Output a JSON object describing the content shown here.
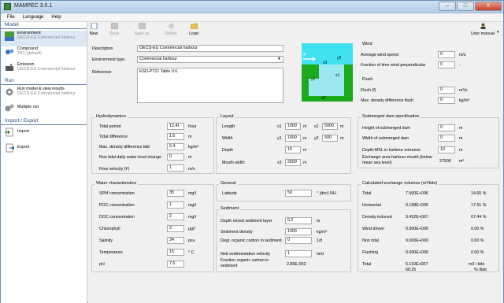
{
  "app": {
    "title": "MAMPEC 3.0.1"
  },
  "window_buttons": {
    "minimize": "–",
    "maximize": "□",
    "close": "X"
  },
  "menu": [
    "File",
    "Language",
    "Help"
  ],
  "sidebar": {
    "model_header": "Model",
    "model_items": [
      {
        "label": "Environment",
        "sub": "OECD-EU Commercial harbour"
      },
      {
        "label": "Compound",
        "sub": "TBT (default)"
      },
      {
        "label": "Emission",
        "sub": "OECD-EU Commercial harbour"
      }
    ],
    "run_header": "Run",
    "run_items": [
      {
        "label": "Run model & view results",
        "sub": "OECD-EU Commercial harbour"
      },
      {
        "label": "Multiple run",
        "sub": ""
      }
    ],
    "io_header": "Import / Export",
    "io_items": [
      {
        "label": "Import"
      },
      {
        "label": "Export"
      }
    ]
  },
  "toolbar": {
    "new": "New",
    "save": "Save",
    "save_as": "Save as new",
    "delete": "Delete",
    "load": "Load",
    "user_manual": "User manual"
  },
  "env": {
    "description_label": "Description",
    "description": "OECD-EU Commercial harbour",
    "type_label": "Environment type",
    "type": "Commercial harbour",
    "reference_label": "Reference",
    "reference": "ESD-PT21 Table 0.6"
  },
  "diagram": {
    "F": "F",
    "x1": "x1",
    "x2": "x2",
    "x3": "x3",
    "y1": "y1",
    "y2": "y2"
  },
  "wind": {
    "title": "Wind",
    "rows": [
      {
        "label": "Average wind speed",
        "value": "0",
        "unit": "m/s"
      },
      {
        "label": "Fraction of time wind perpendicular",
        "value": "0",
        "unit": "-"
      }
    ]
  },
  "flush": {
    "title": "Flush",
    "rows": [
      {
        "label": "Flush (f)",
        "value": "0",
        "unit": "m³/s"
      },
      {
        "label": "Max. density difference flush",
        "value": "0",
        "unit": "kg/m³"
      }
    ]
  },
  "dam": {
    "title": "Submerged dam specification",
    "rows": [
      {
        "label": "Height of submerged dam",
        "value": "0",
        "unit": "m"
      },
      {
        "label": "Width of submerged dam",
        "value": "0",
        "unit": "m"
      },
      {
        "label": "Depth-MSL in harbour entrance",
        "value": "10",
        "unit": "m"
      }
    ],
    "exch_label": "Exchange area harbour mouth (below mean sea level)",
    "exch_value": "37500",
    "exch_unit": "m²"
  },
  "hydro": {
    "title": "Hydrodynamics",
    "rows": [
      {
        "label": "Tidal period",
        "value": "12.41",
        "unit": "hour"
      },
      {
        "label": "Tidal difference",
        "value": "1.5",
        "unit": "m"
      },
      {
        "label": "Max. density difference tide",
        "value": "0.4",
        "unit": "kg/m³"
      },
      {
        "label": "Non tidal daily water level change",
        "value": "0",
        "unit": "m"
      },
      {
        "label": "Flow velocity (F)",
        "value": "1",
        "unit": "m/s"
      }
    ]
  },
  "layout": {
    "title": "Layout",
    "length_label": "Length",
    "x1_label": "x1",
    "x1": "1000",
    "x1_unit": "m",
    "x2_label": "x2",
    "x2": "5000",
    "x2_unit": "m",
    "width_label": "Width",
    "y1_label": "y1",
    "y1": "1000",
    "y1_unit": "m",
    "y2_label": "y2",
    "y2": "500",
    "y2_unit": "m",
    "depth_label": "Depth",
    "depth": "15",
    "depth_unit": "m",
    "mouth_label": "Mouth width",
    "x3_label": "x3",
    "x3": "2500",
    "x3_unit": "m"
  },
  "water": {
    "title": "Water characteristics",
    "rows": [
      {
        "label": "SPM concentration",
        "value": "35",
        "unit": "mg/l"
      },
      {
        "label": "POC concentration",
        "value": "1",
        "unit": "mg/l"
      },
      {
        "label": "DOC concentration",
        "value": "2",
        "unit": "mg/l"
      },
      {
        "label": "Chlorophyll",
        "value": "3",
        "unit": "µg/l"
      },
      {
        "label": "Salinity",
        "value": "34",
        "unit": "psu"
      },
      {
        "label": "Temperature",
        "value": "15",
        "unit": "° C"
      },
      {
        "label": "pH",
        "value": "7.5",
        "unit": ""
      }
    ]
  },
  "general": {
    "title": "General",
    "lat_label": "Latitude",
    "lat": "50",
    "lat_unit": "° (dec) NH"
  },
  "sediment": {
    "title": "Sediment",
    "rows": [
      {
        "label": "Depth mixed sediment layer",
        "value": "0.2",
        "unit": "m"
      },
      {
        "label": "Sediment density",
        "value": "1000",
        "unit": "kg/m³"
      },
      {
        "label": "Degr. organic carbon in sediment",
        "value": "0",
        "unit": "1/d"
      },
      {
        "label": "Nett sedimentation velocity",
        "value": "1",
        "unit": "m/d"
      }
    ],
    "frac_label": "Fraction organic carbon in sediment",
    "frac_value": "2.85E-002"
  },
  "exchange": {
    "title": "Calculated exchange volumes (m³/tide)",
    "rows": [
      {
        "label": "Tidal",
        "value": "7.500E+006",
        "pct": "14.65 %"
      },
      {
        "label": "Horizontal",
        "value": "9.168E+006",
        "pct": "17.91 %"
      },
      {
        "label": "Density induced",
        "value": "3.452E+007",
        "pct": "67.44 %"
      },
      {
        "label": "Wind driven",
        "value": "0.000E+000",
        "pct": "0.00 %"
      },
      {
        "label": "Non tidal",
        "value": "0.000E+000",
        "pct": "0.00 %"
      },
      {
        "label": "Flushing",
        "value": "0.000E+000",
        "pct": "0.00 %"
      }
    ],
    "total_label": "Total",
    "total_value": "5.119E+007",
    "total_unit": "m3 / tide",
    "pct_value": "68.25",
    "pct_unit": "% /tide"
  }
}
